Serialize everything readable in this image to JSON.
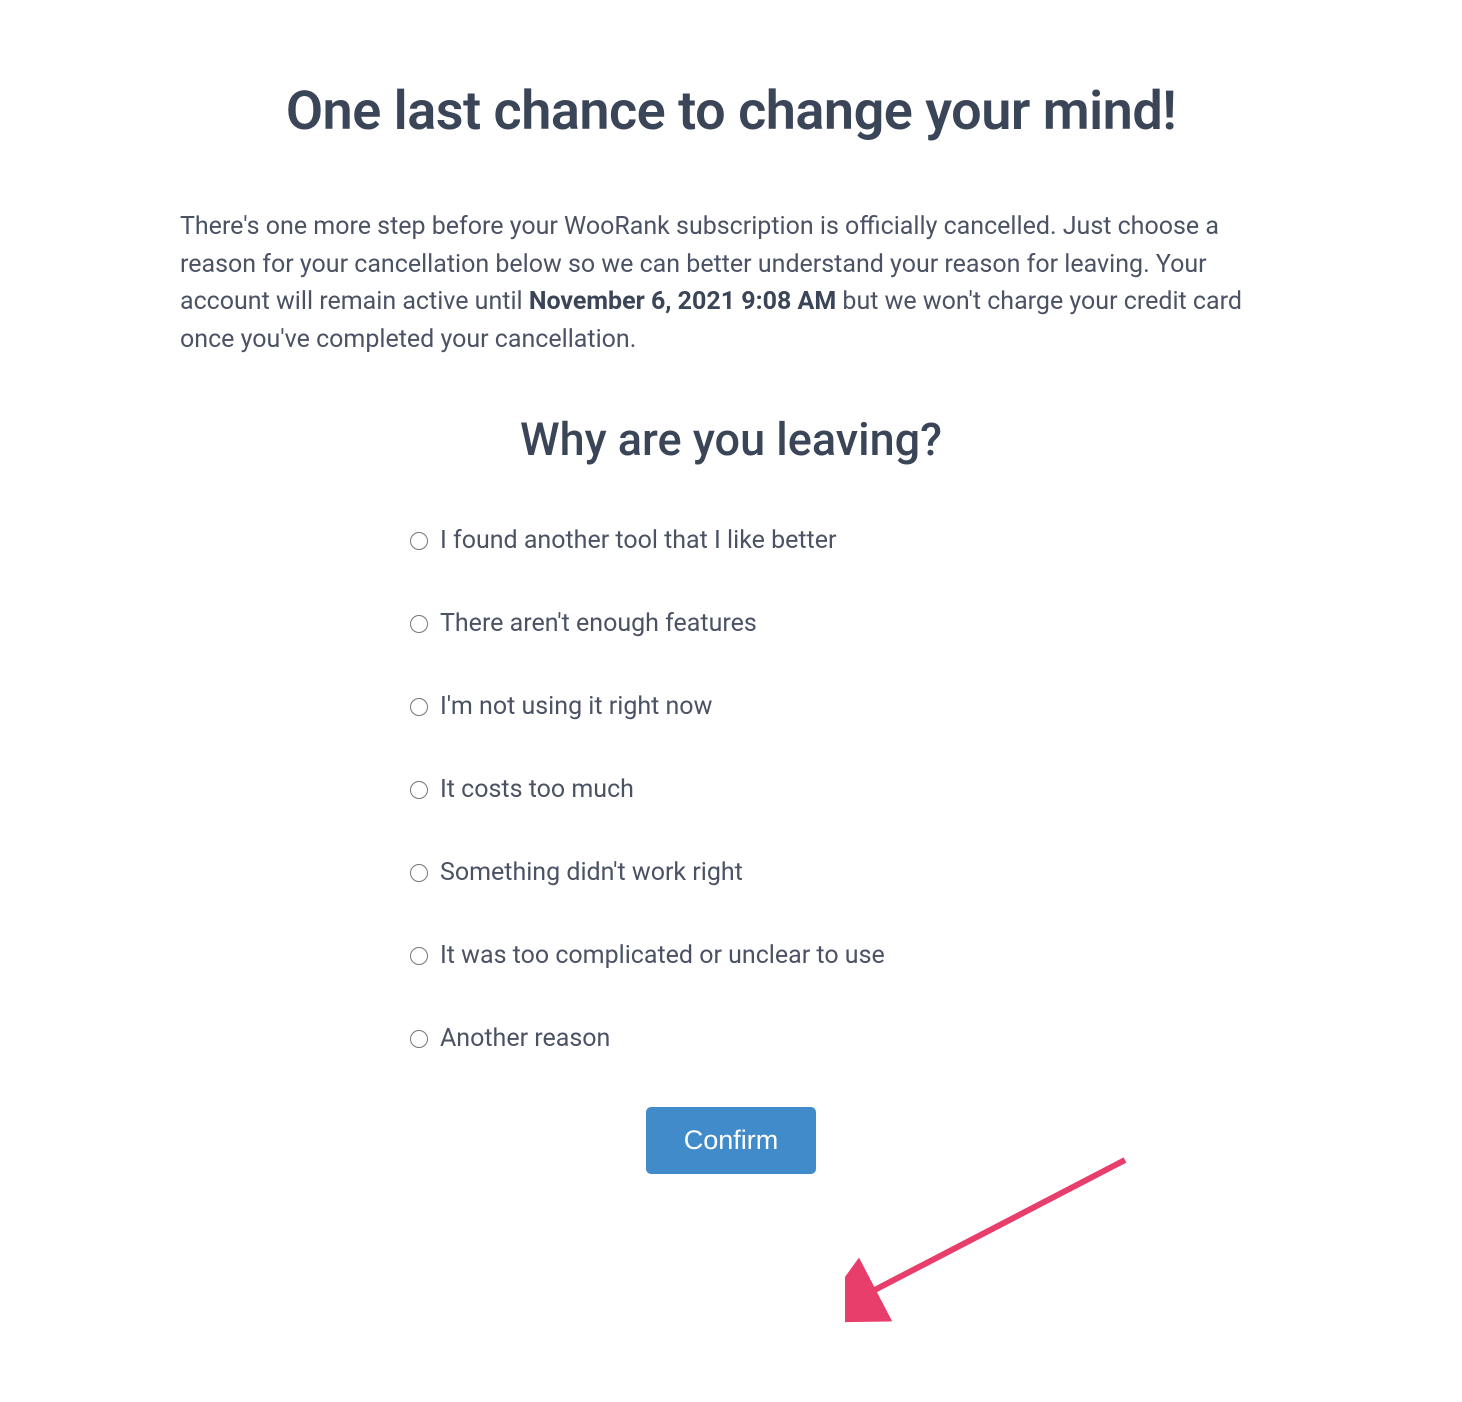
{
  "header": {
    "title": "One last chance to change your mind!"
  },
  "description": {
    "text_before": "There's one more step before your WooRank subscription is officially cancelled. Just choose a reason for your cancellation below so we can better understand your reason for leaving. Your account will remain active until ",
    "active_until": "November 6, 2021 9:08 AM",
    "text_after": " but we won't charge your credit card once you've completed your cancellation."
  },
  "form": {
    "question": "Why are you leaving?",
    "reasons": [
      "I found another tool that I like better",
      "There aren't enough features",
      "I'm not using it right now",
      "It costs too much",
      "Something didn't work right",
      "It was too complicated or unclear to use",
      "Another reason"
    ],
    "confirm_label": "Confirm"
  }
}
